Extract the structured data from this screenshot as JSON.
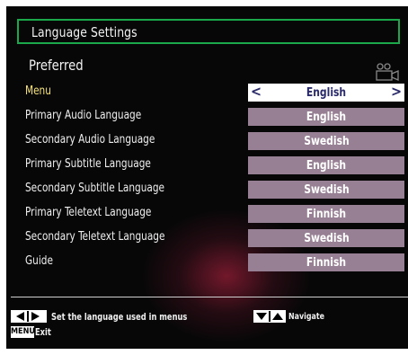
{
  "header": {
    "title": "Language Settings",
    "subtitle": "Preferred"
  },
  "icons": {
    "camera": "camera-icon"
  },
  "rows": [
    {
      "label": "Menu",
      "value": "English",
      "selected": true
    },
    {
      "label": "Primary Audio Language",
      "value": "English",
      "selected": false
    },
    {
      "label": "Secondary Audio Language",
      "value": "Swedish",
      "selected": false
    },
    {
      "label": "Primary Subtitle Language",
      "value": "English",
      "selected": false
    },
    {
      "label": "Secondary Subtitle Language",
      "value": "Swedish",
      "selected": false
    },
    {
      "label": "Primary Teletext Language",
      "value": "Finnish",
      "selected": false
    },
    {
      "label": "Secondary Teletext Language",
      "value": "Swedish",
      "selected": false
    },
    {
      "label": "Guide",
      "value": "Finnish",
      "selected": false
    }
  ],
  "footer": {
    "help": "Set the language used in menus",
    "menu_key": "MENU",
    "exit": "Exit",
    "navigate": "Navigate"
  },
  "colors": {
    "title_border": "#1aa84a",
    "value_bg": "#978093",
    "selected_bg": "#ffffff",
    "highlight_label": "#f6e27a"
  }
}
